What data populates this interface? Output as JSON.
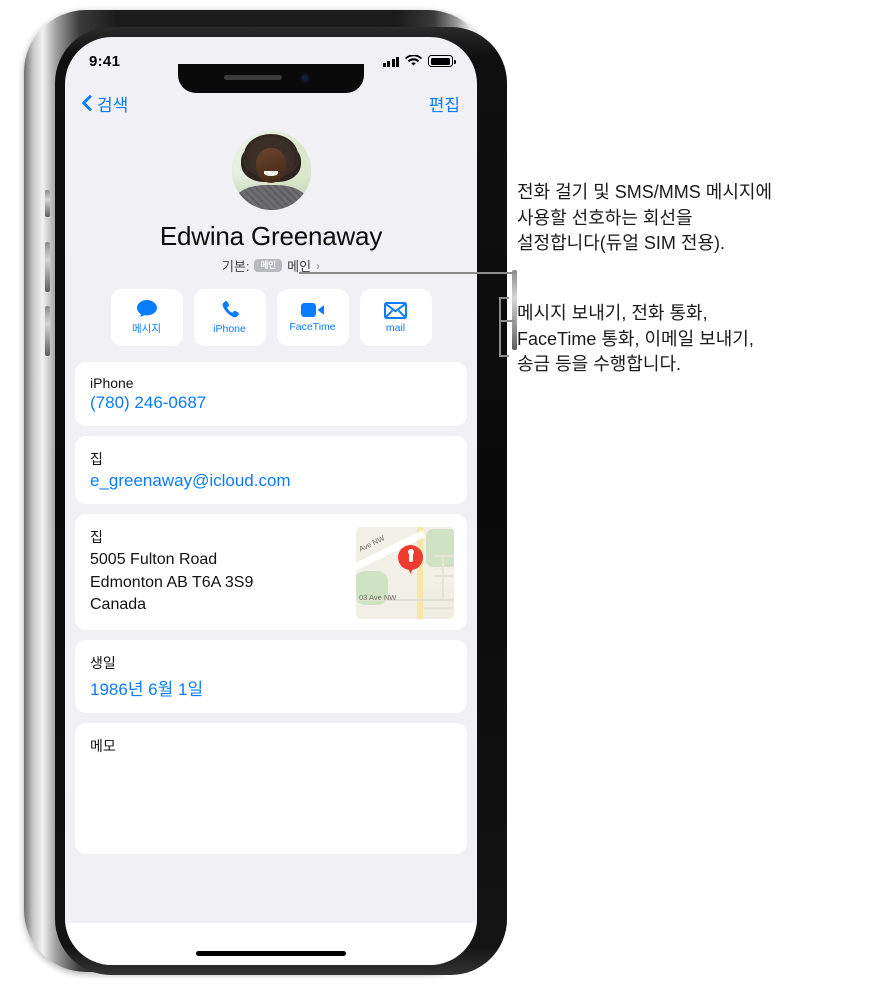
{
  "status_bar": {
    "time": "9:41",
    "signal_icon": "cellular-signal-icon",
    "wifi_icon": "wifi-icon",
    "battery_icon": "battery-icon"
  },
  "nav": {
    "back_label": "검색",
    "back_icon": "chevron-left-icon",
    "edit_label": "편집"
  },
  "contact": {
    "avatar_alt": "contact-photo",
    "name": "Edwina Greenaway",
    "default_prefix": "기본:",
    "default_badge": "메인",
    "default_value": "메인",
    "default_chevron": "›"
  },
  "actions": [
    {
      "label": "메시지",
      "icon": "message-bubble-icon"
    },
    {
      "label": "iPhone",
      "icon": "phone-handset-icon"
    },
    {
      "label": "FaceTime",
      "icon": "video-camera-icon"
    },
    {
      "label": "mail",
      "icon": "envelope-icon"
    }
  ],
  "fields": {
    "phone": {
      "label": "iPhone",
      "value": "(780) 246-0687"
    },
    "email": {
      "label": "집",
      "value": "e_greenaway@icloud.com"
    },
    "address": {
      "label": "집",
      "line1": "5005 Fulton Road",
      "line2": "Edmonton AB T6A 3S9",
      "line3": "Canada",
      "map_label_1": "Ave NW",
      "map_label_2": "03 Ave NW",
      "map_pin_icon": "map-pin-icon",
      "pin_color": "#ef3b2f"
    },
    "birthday": {
      "label": "생일",
      "value": "1986년 6월 1일"
    },
    "notes": {
      "label": "메모",
      "value": ""
    }
  },
  "annotations": [
    {
      "text": "전화 걸기 및 SMS/MMS 메시지에\n사용할 선호하는 회선을\n설정합니다(듀얼 SIM 전용)."
    },
    {
      "text": "메시지 보내기, 전화 통화,\nFaceTime 통화, 이메일 보내기,\n송금 등을 수행합니다."
    }
  ],
  "colors": {
    "accent_blue": "#0a7cff",
    "screen_bg": "#f1f1f5",
    "card_bg": "#ffffff",
    "pin_red": "#ef3b2f"
  }
}
